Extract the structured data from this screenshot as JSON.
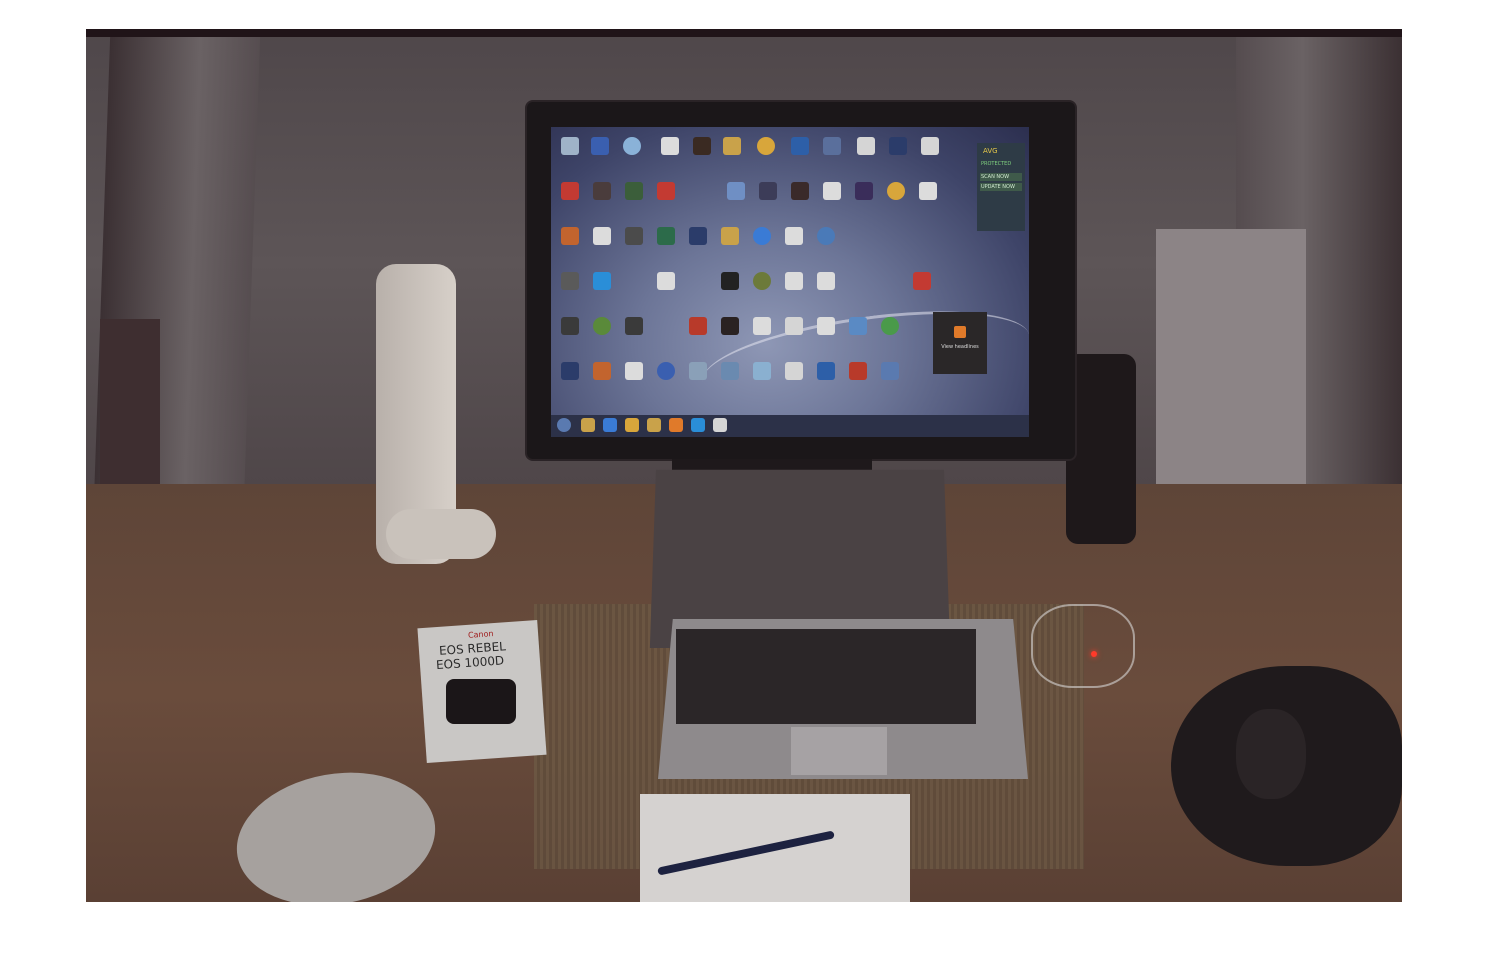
{
  "scene": {
    "description_free": true,
    "manual_brand": "Canon",
    "manual_title_1": "EOS REBEL",
    "manual_title_2": "EOS 1000D",
    "avg_widget": {
      "title": "AVG",
      "status": "PROTECTED",
      "scan_label": "SCAN NOW",
      "update_label": "UPDATE NOW"
    },
    "headlines_label": "View headlines"
  },
  "colors": {
    "wall": "#5d5557",
    "desk": "#6a4c3c",
    "screen": "#6c7597",
    "taskbar": "#2c3148",
    "led": "#ff3a2a"
  },
  "icons": [
    "recycle-bin-icon",
    "folder-icon",
    "itunes-icon",
    "document-icon",
    "game-icon",
    "chrome-icon",
    "acrobat-icon",
    "skype-icon",
    "word-icon",
    "app-icon"
  ]
}
